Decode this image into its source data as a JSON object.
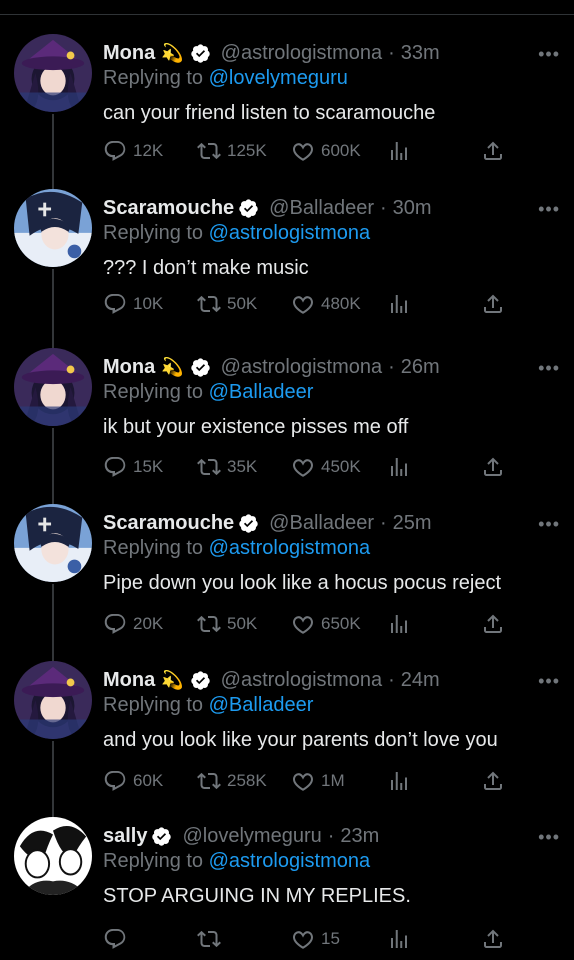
{
  "tweets": [
    {
      "name": "Mona",
      "has_sparkle": true,
      "handle": "@astrologistmona",
      "time": "33m",
      "replying_prefix": "Replying to",
      "replying_to": "@lovelymeguru",
      "text": "can your friend listen to scaramouche",
      "replies": "12K",
      "retweets": "125K",
      "likes": "600K"
    },
    {
      "name": "Scaramouche",
      "has_sparkle": false,
      "handle": "@Balladeer",
      "time": "30m",
      "replying_prefix": "Replying to",
      "replying_to": "@astrologistmona",
      "text": "??? I don’t make music",
      "replies": "10K",
      "retweets": "50K",
      "likes": "480K"
    },
    {
      "name": "Mona",
      "has_sparkle": true,
      "handle": "@astrologistmona",
      "time": "26m",
      "replying_prefix": "Replying to",
      "replying_to": "@Balladeer",
      "text": "ik but your existence pisses me off",
      "replies": "15K",
      "retweets": "35K",
      "likes": "450K"
    },
    {
      "name": "Scaramouche",
      "has_sparkle": false,
      "handle": "@Balladeer",
      "time": "25m",
      "replying_prefix": "Replying to",
      "replying_to": "@astrologistmona",
      "text": "Pipe down you look like a hocus pocus reject",
      "replies": "20K",
      "retweets": "50K",
      "likes": "650K"
    },
    {
      "name": "Mona",
      "has_sparkle": true,
      "handle": "@astrologistmona",
      "time": "24m",
      "replying_prefix": "Replying to",
      "replying_to": "@Balladeer",
      "text": "and you look like your parents don’t love you",
      "replies": "60K",
      "retweets": "258K",
      "likes": "1M"
    },
    {
      "name": "sally",
      "has_sparkle": false,
      "handle": "@lovelymeguru",
      "time": "23m",
      "replying_prefix": "Replying to",
      "replying_to": "@astrologistmona",
      "text": "STOP ARGUING IN MY REPLIES.",
      "replies": "",
      "retweets": "",
      "likes": "15"
    }
  ],
  "ui": {
    "sparkle_glyph": "💫",
    "dot": "·",
    "more_glyph": "•••"
  },
  "colors": {
    "background": "#000000",
    "text": "#e7e9ea",
    "muted": "#71767b",
    "link": "#1d9bf0",
    "verified": "#ffffff",
    "thread_line": "#333639"
  }
}
